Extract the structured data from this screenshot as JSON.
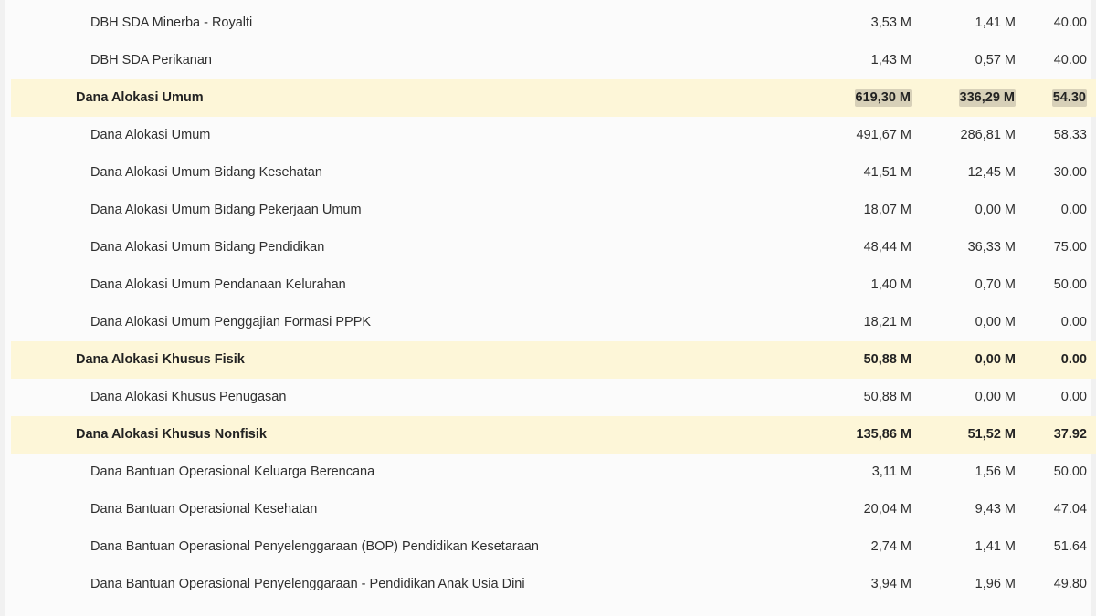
{
  "rows": [
    {
      "type": "item",
      "label": "DBH SDA Minerba - Royalti",
      "col1": "3,53 M",
      "col2": "1,41 M",
      "col3": "40.00"
    },
    {
      "type": "item",
      "label": "DBH SDA Perikanan",
      "col1": "1,43 M",
      "col2": "0,57 M",
      "col3": "40.00"
    },
    {
      "type": "group",
      "label": "Dana Alokasi Umum",
      "col1": "619,30 M",
      "col2": "336,29 M",
      "col3": "54.30"
    },
    {
      "type": "item",
      "label": "Dana Alokasi Umum",
      "col1": "491,67 M",
      "col2": "286,81 M",
      "col3": "58.33"
    },
    {
      "type": "item",
      "label": "Dana Alokasi Umum Bidang Kesehatan",
      "col1": "41,51 M",
      "col2": "12,45 M",
      "col3": "30.00"
    },
    {
      "type": "item",
      "label": "Dana Alokasi Umum Bidang Pekerjaan Umum",
      "col1": "18,07 M",
      "col2": "0,00 M",
      "col3": "0.00"
    },
    {
      "type": "item",
      "label": "Dana Alokasi Umum Bidang Pendidikan",
      "col1": "48,44 M",
      "col2": "36,33 M",
      "col3": "75.00"
    },
    {
      "type": "item",
      "label": "Dana Alokasi Umum Pendanaan Kelurahan",
      "col1": "1,40 M",
      "col2": "0,70 M",
      "col3": "50.00"
    },
    {
      "type": "item",
      "label": "Dana Alokasi Umum Penggajian Formasi PPPK",
      "col1": "18,21 M",
      "col2": "0,00 M",
      "col3": "0.00"
    },
    {
      "type": "group",
      "label": "Dana Alokasi Khusus Fisik",
      "col1": "50,88 M",
      "col2": "0,00 M",
      "col3": "0.00"
    },
    {
      "type": "item",
      "label": "Dana Alokasi Khusus Penugasan",
      "col1": "50,88 M",
      "col2": "0,00 M",
      "col3": "0.00"
    },
    {
      "type": "group",
      "label": "Dana Alokasi Khusus Nonfisik",
      "col1": "135,86 M",
      "col2": "51,52 M",
      "col3": "37.92"
    },
    {
      "type": "item",
      "label": "Dana Bantuan Operasional Keluarga Berencana",
      "col1": "3,11 M",
      "col2": "1,56 M",
      "col3": "50.00"
    },
    {
      "type": "item",
      "label": "Dana Bantuan Operasional Kesehatan",
      "col1": "20,04 M",
      "col2": "9,43 M",
      "col3": "47.04"
    },
    {
      "type": "item",
      "label": "Dana Bantuan Operasional Penyelenggaraan (BOP) Pendidikan Kesetaraan",
      "col1": "2,74 M",
      "col2": "1,41 M",
      "col3": "51.64"
    },
    {
      "type": "item",
      "label": "Dana Bantuan Operasional Penyelenggaraan - Pendidikan Anak Usia Dini",
      "col1": "3,94 M",
      "col2": "1,96 M",
      "col3": "49.80"
    }
  ]
}
